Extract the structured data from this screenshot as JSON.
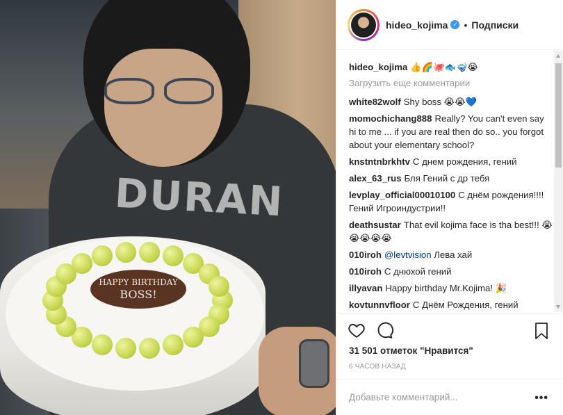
{
  "post": {
    "author": "hideo_kojima",
    "verified_icon": "verified-badge-icon",
    "separator": "•",
    "follow_status": "Подписки",
    "caption_user": "hideo_kojima",
    "caption_text": "👍🌈🐙🐟🤿😭",
    "load_more": "Загрузить еще комментарии",
    "likes": "31 501 отметок \"Нравится\"",
    "timestamp": "6 ЧАСОВ НАЗАД",
    "comment_placeholder": "Добавьте комментарий...",
    "more_label": "•••"
  },
  "photo": {
    "shirt_text": "DURAN",
    "plaque_line1": "HAPPY BIRTHDAY",
    "plaque_line2": "BOSS!"
  },
  "comments": [
    {
      "user": "white82wolf",
      "text": "Shy boss 😭😭💙"
    },
    {
      "user": "momochichang888",
      "text": "Really? You can't even say hi to me ... if you are real then do so.. you forgot about your elementary school?"
    },
    {
      "user": "knstntnbrkhtv",
      "text": "С днем рождения, гений"
    },
    {
      "user": "alex_63_rus",
      "text": "Бля Гений с др тебя"
    },
    {
      "user": "levplay_official00010100",
      "text": "С днём рождения!!!! Гений Игроиндустрии!!"
    },
    {
      "user": "deathsustar",
      "text": "That evil kojima face is tha best!!! 😭😭😭😭😭"
    },
    {
      "user": "010iroh",
      "mention": "@levtvision",
      "text": "Лева хай"
    },
    {
      "user": "010iroh",
      "text": "С днюхой гений"
    },
    {
      "user": "illyavan",
      "text": "Happy birthday Mr.Kojima! 🎉"
    },
    {
      "user": "kovtunnvfloor",
      "text": "С Днём Рождения, гений"
    }
  ],
  "icons": {
    "like": "heart-icon",
    "comment": "comment-bubble-icon",
    "save": "bookmark-icon"
  },
  "colors": {
    "text": "#262626",
    "muted": "#999999",
    "verified": "#3897f0",
    "mention": "#003569",
    "border": "#efefef"
  }
}
